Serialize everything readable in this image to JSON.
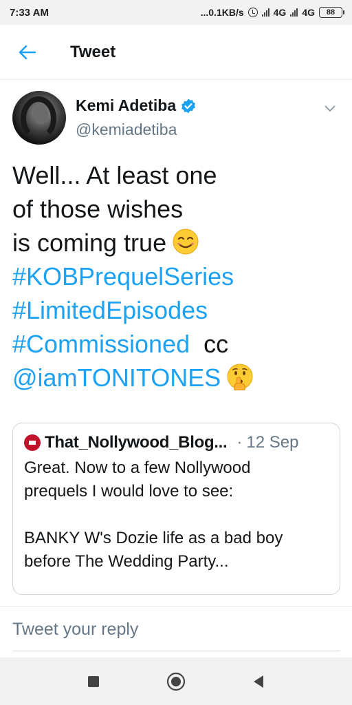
{
  "status_bar": {
    "time": "7:33 AM",
    "network_speed": "...0.1KB/s",
    "network_type_1": "4G",
    "network_type_2": "4G",
    "battery": "88"
  },
  "header": {
    "title": "Tweet"
  },
  "tweet": {
    "author_name": "Kemi Adetiba",
    "author_handle": "@kemiadetiba",
    "lines": [
      "Well... At least one",
      "of those wishes",
      "is coming true"
    ],
    "hashtags": [
      "#KOBPrequelSeries",
      "#LimitedEpisodes",
      "#Commissioned"
    ],
    "cc_text": "cc",
    "mention": "@iamTONITONES"
  },
  "quoted_tweet": {
    "author_name": "That_Nollywood_Blog...",
    "separator": "·",
    "date": "12 Sep",
    "lines": [
      "Great. Now to a few Nollywood",
      "prequels I would love to see:",
      "",
      "BANKY W's Dozie life as a bad boy",
      "before The Wedding Party..."
    ]
  },
  "reply": {
    "placeholder": "Tweet your reply"
  },
  "colors": {
    "accent": "#1da1f2",
    "text": "#14171a",
    "muted": "#657786"
  }
}
